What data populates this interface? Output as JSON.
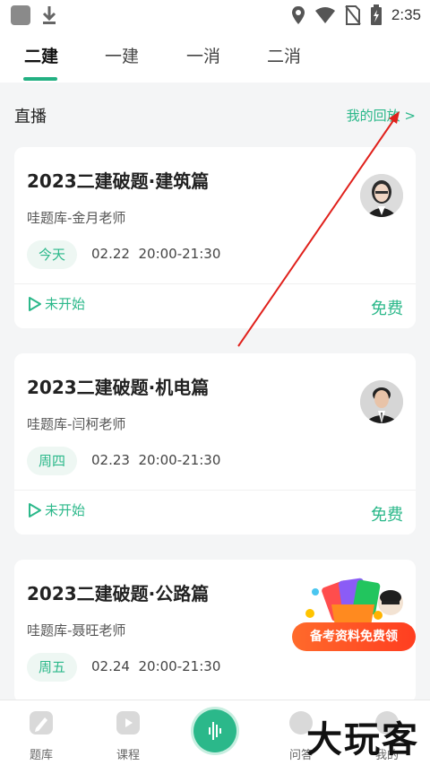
{
  "status_bar": {
    "time": "2:35"
  },
  "tabs": [
    {
      "label": "二建",
      "active": true
    },
    {
      "label": "一建",
      "active": false
    },
    {
      "label": "一消",
      "active": false
    },
    {
      "label": "二消",
      "active": false
    }
  ],
  "section": {
    "title": "直播",
    "link": "我的回放 >"
  },
  "courses": [
    {
      "title": "2023二建破题·建筑篇",
      "teacher": "哇题库-金月老师",
      "day": "今天",
      "date": "02.22",
      "time": "20:00-21:30",
      "status": "未开始",
      "price": "免费"
    },
    {
      "title": "2023二建破题·机电篇",
      "teacher": "哇题库-闫柯老师",
      "day": "周四",
      "date": "02.23",
      "time": "20:00-21:30",
      "status": "未开始",
      "price": "免费"
    },
    {
      "title": "2023二建破题·公路篇",
      "teacher": "哇题库-聂旺老师",
      "day": "周五",
      "date": "02.24",
      "time": "20:00-21:30"
    }
  ],
  "promo": {
    "label": "备考资料免费领"
  },
  "bottom_nav": [
    {
      "label": "题库"
    },
    {
      "label": "课程"
    },
    {
      "label": ""
    },
    {
      "label": "问答"
    },
    {
      "label": "我的"
    }
  ],
  "watermark": "大玩客",
  "colors": {
    "accent": "#2bb88a",
    "arrow": "#e0201b",
    "promo": "#ff4a22"
  }
}
